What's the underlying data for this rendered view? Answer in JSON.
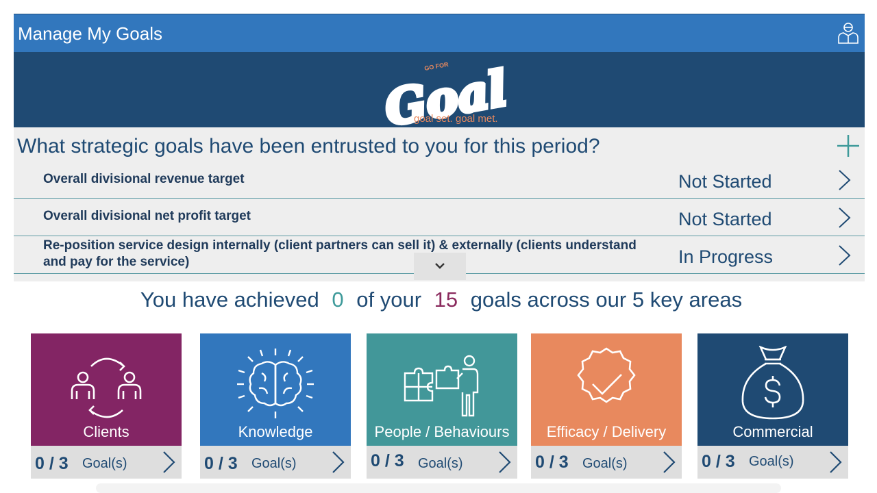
{
  "header": {
    "title": "Manage My Goals",
    "user_icon": "user-profile-icon",
    "bar_color": "#3277bd"
  },
  "banner": {
    "logo_small": "GO FOR",
    "logo_main": "Goal",
    "tagline": "goal set. goal met.",
    "background": "#1f4a73",
    "tagline_color": "#e8895e"
  },
  "goals": {
    "question": "What strategic goals have been entrusted to you for this period?",
    "add_icon": "plus-icon",
    "items": [
      {
        "title": "Overall divisional revenue target",
        "status": "Not Started"
      },
      {
        "title": "Overall divisional net profit target",
        "status": "Not Started"
      },
      {
        "title": "Re-position service design internally (client partners can sell it) & externally (clients understand and pay for the service)",
        "status": "In Progress"
      }
    ],
    "scroll_icon": "chevron-down-icon"
  },
  "summary": {
    "prefix": "You have achieved",
    "achieved": "0",
    "middle": "of your",
    "total": "15",
    "suffix": "goals across our 5 key areas",
    "achieved_color": "#3e9a9a",
    "total_color": "#8a2a5d"
  },
  "areas": [
    {
      "label": "Clients",
      "count": "0 / 3",
      "goals_label": "Goal(s)",
      "icon": "people-exchange-icon",
      "color": "#832564"
    },
    {
      "label": "Knowledge",
      "count": "0 / 3",
      "goals_label": "Goal(s)",
      "icon": "brain-icon",
      "color": "#3277bd"
    },
    {
      "label": "People / Behaviours",
      "count": "0 / 3",
      "goals_label": "Goal(s)",
      "icon": "puzzle-person-icon",
      "color": "#429799"
    },
    {
      "label": "Efficacy / Delivery",
      "count": "0 / 3",
      "goals_label": "Goal(s)",
      "icon": "check-badge-icon",
      "color": "#e8895e"
    },
    {
      "label": "Commercial",
      "count": "0 / 3",
      "goals_label": "Goal(s)",
      "icon": "money-bag-icon",
      "color": "#1f4a73"
    }
  ]
}
